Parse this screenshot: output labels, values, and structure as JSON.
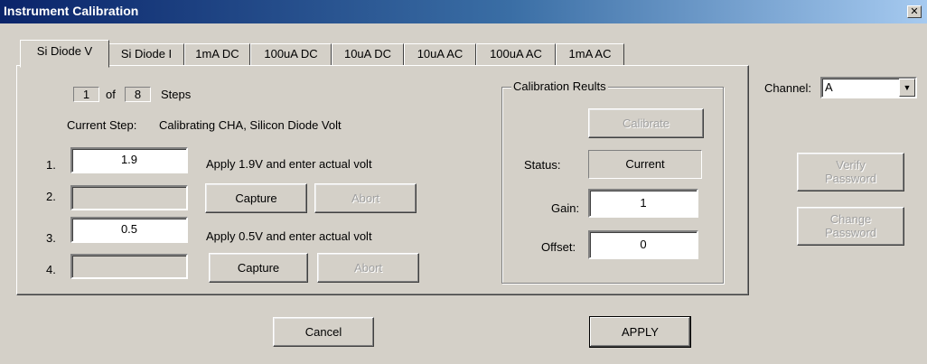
{
  "window": {
    "title": "Instrument Calibration",
    "close_glyph": "✕"
  },
  "tabs": [
    {
      "label": "Si Diode V",
      "active": true
    },
    {
      "label": "Si Diode I"
    },
    {
      "label": "1mA DC"
    },
    {
      "label": "100uA DC"
    },
    {
      "label": "10uA DC"
    },
    {
      "label": "10uA AC"
    },
    {
      "label": "100uA AC"
    },
    {
      "label": "1mA AC"
    }
  ],
  "steps": {
    "current": "1",
    "of_label": "of",
    "total": "8",
    "steps_label": "Steps",
    "current_step_label": "Current Step:",
    "current_step_text": "Calibrating CHA, Silicon Diode Volt"
  },
  "rows": [
    {
      "num": "1.",
      "value": "1.9",
      "instruction": "Apply 1.9V and enter actual volt"
    },
    {
      "num": "2.",
      "value": "",
      "capture": "Capture",
      "abort": "Abort"
    },
    {
      "num": "3.",
      "value": "0.5",
      "instruction": "Apply 0.5V and enter actual volt"
    },
    {
      "num": "4.",
      "value": "",
      "capture": "Capture",
      "abort": "Abort"
    }
  ],
  "results": {
    "title": "Calibration Reults",
    "calibrate_label": "Calibrate",
    "status_label": "Status:",
    "status_value": "Current",
    "gain_label": "Gain:",
    "gain_value": "1",
    "offset_label": "Offset:",
    "offset_value": "0"
  },
  "channel": {
    "label": "Channel:",
    "value": "A"
  },
  "password": {
    "verify_line1": "Verify",
    "verify_line2": "Password",
    "change_line1": "Change",
    "change_line2": "Password"
  },
  "footer": {
    "cancel_label": "Cancel",
    "apply_label": "APPLY"
  }
}
